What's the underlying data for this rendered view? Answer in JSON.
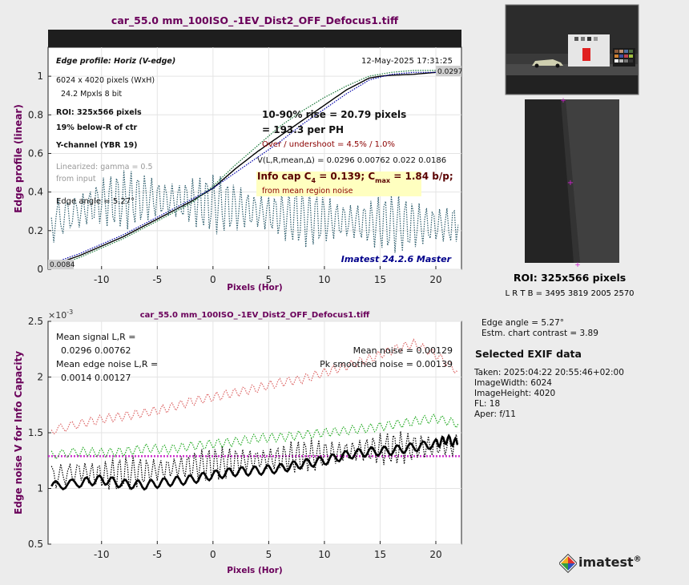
{
  "window": {
    "title": "car_55.0 mm_100ISO_-1EV_Dist2_OFF_Defocus1.tiff"
  },
  "top_panel": {
    "header": "Edge profile: Horiz (V-edge)",
    "date": "12-May-2025 17:31:25",
    "pixels": "6024 x 4020 pixels (WxH)",
    "mpx": "24.2 Mpxls  8 bit",
    "roi": "ROI:  325x566 pixels",
    "below": "19% below-R of ctr",
    "channel": "Y-channel  (YBR 19)",
    "linearized_1": "Linearized: gamma = 0.5",
    "linearized_2": "from input",
    "edge_angle": "Edge angle = 5.27°",
    "rise_1": "10-90% rise = 20.79 pixels",
    "rise_2": "=  193.3 per PH",
    "overshoot": "Over / undershoot =  4.5% /  1.0%",
    "vlr": "V(L,R,mean,Δ) = 0.0296  0.00762  0.022  0.0186",
    "info_cap_prefix": "Info cap C",
    "info_cap_sub": "4",
    "info_cap_mid": " = 0.139;  C",
    "info_cap_sub2": "max",
    "info_cap_end": " = 1.84 b/p;",
    "info_note": "from mean region noise",
    "version": "Imatest 24.2.6 Master",
    "left_value": "0.0084",
    "right_value": "0.0297"
  },
  "bottom_panel": {
    "title": "car_55.0 mm_100ISO_-1EV_Dist2_OFF_Defocus1.tiff",
    "exponent": "×10",
    "exponent_pow": "-3",
    "mean_signal_label": "Mean signal L,R =",
    "mean_signal_value": "0.0296  0.00762",
    "mean_edge_noise_label": "Mean edge noise L,R =",
    "mean_edge_noise_value": "0.0014  0.00127",
    "mean_noise": "Mean noise = 0.00129",
    "pk_noise": "Pk smoothed noise = 0.00139"
  },
  "sidebar": {
    "roi_title": "ROI:  325x566 pixels",
    "roi_coords": "L R  T B = 3495 3819  2005 2570",
    "edge_angle": "Edge angle = 5.27°",
    "contrast": "Estm. chart contrast = 3.89",
    "exif_title": "Selected EXIF data",
    "exif": [
      "Taken: 2025:04:22 20:55:46+02:00",
      "ImageWidth:  6024",
      "ImageHeight:  4020",
      "FL:    18",
      "Aper:  f/11"
    ]
  },
  "logo": {
    "text": "imatest",
    "mark": "®"
  },
  "colors": {
    "title": "#6a005a",
    "accent_blue": "#00008b",
    "noise_pink": "#cc33cc",
    "info_bg": "#ffffc0",
    "info_text": "#8b0000"
  },
  "chart_data": [
    {
      "type": "line",
      "title": "",
      "xlabel": "Pixels (Hor)",
      "ylabel": "Edge profile (linear)",
      "xlim": [
        -14.8,
        22.3
      ],
      "ylim": [
        0,
        1.15
      ],
      "xticks": [
        -10,
        -5,
        0,
        5,
        10,
        15,
        20
      ],
      "yticks": [
        0,
        0.2,
        0.4,
        0.6,
        0.8,
        1
      ],
      "series": [
        {
          "color": "#000000",
          "style": "solid",
          "x": [
            -14.5,
            -12,
            -10,
            -8,
            -6,
            -4,
            -2,
            0,
            2,
            4,
            6,
            8,
            10,
            12,
            14,
            15,
            16,
            18,
            20,
            22
          ],
          "y": [
            0.02,
            0.07,
            0.12,
            0.17,
            0.23,
            0.29,
            0.35,
            0.42,
            0.52,
            0.61,
            0.69,
            0.77,
            0.85,
            0.93,
            0.99,
            1.0,
            1.005,
            1.01,
            1.02,
            1.03
          ]
        },
        {
          "color": "#1a7a3a",
          "style": "dotted",
          "x": [
            -14.5,
            -12,
            -10,
            -8,
            -6,
            -4,
            -2,
            0,
            2,
            4,
            6,
            8,
            10,
            12,
            14,
            16,
            18,
            20,
            22
          ],
          "y": [
            0.01,
            0.06,
            0.11,
            0.16,
            0.22,
            0.28,
            0.34,
            0.43,
            0.54,
            0.64,
            0.74,
            0.82,
            0.89,
            0.95,
            1.0,
            1.02,
            1.03,
            1.03,
            1.04
          ]
        },
        {
          "color": "#0000aa",
          "style": "dotted",
          "x": [
            -14.5,
            -12,
            -10,
            -8,
            -6,
            -4,
            -2,
            0,
            2,
            4,
            6,
            8,
            10,
            12,
            14,
            16,
            18,
            20,
            22
          ],
          "y": [
            0.03,
            0.08,
            0.13,
            0.18,
            0.24,
            0.3,
            0.36,
            0.42,
            0.5,
            0.58,
            0.66,
            0.75,
            0.83,
            0.91,
            0.98,
            1.01,
            1.02,
            1.02,
            1.03
          ]
        },
        {
          "color": "#2a5a6a",
          "style": "dotted",
          "noise": true,
          "x": [
            -14.5,
            -12,
            -10,
            -8,
            -6,
            -4,
            -2,
            0,
            2,
            4,
            6,
            8,
            10,
            12,
            14,
            16,
            18,
            20,
            22
          ],
          "y": [
            0.25,
            0.3,
            0.35,
            0.36,
            0.37,
            0.36,
            0.35,
            0.34,
            0.32,
            0.3,
            0.28,
            0.27,
            0.26,
            0.25,
            0.24,
            0.24,
            0.23,
            0.23,
            0.23
          ]
        }
      ]
    },
    {
      "type": "line",
      "title": "car_55.0 mm_100ISO_-1EV_Dist2_OFF_Defocus1.tiff",
      "xlabel": "Pixels (Hor)",
      "ylabel": "Edge noise V for Info Capacity",
      "xlim": [
        -14.8,
        22.3
      ],
      "ylim": [
        0.5,
        2.5
      ],
      "xticks": [
        -10,
        -5,
        0,
        5,
        10,
        15,
        20
      ],
      "yticks": [
        0.5,
        1,
        1.5,
        2,
        2.5
      ],
      "hline": 1.29,
      "series": [
        {
          "color": "#000000",
          "style": "thick",
          "x": [
            -14.5,
            -12,
            -10,
            -8,
            -6,
            -4,
            -2,
            0,
            2,
            4,
            6,
            8,
            10,
            12,
            14,
            16,
            18,
            20,
            21,
            22
          ],
          "y": [
            1.02,
            1.05,
            1.08,
            1.04,
            1.03,
            1.06,
            1.08,
            1.12,
            1.15,
            1.16,
            1.18,
            1.22,
            1.25,
            1.3,
            1.33,
            1.34,
            1.37,
            1.4,
            1.44,
            1.4
          ]
        },
        {
          "color": "#000000",
          "style": "dotted",
          "noise": true,
          "x": [
            -14.5,
            -12,
            -10,
            -8,
            -6,
            -4,
            -2,
            0,
            2,
            4,
            6,
            8,
            10,
            12,
            14,
            16,
            18,
            20,
            22
          ],
          "y": [
            1.1,
            1.15,
            1.12,
            1.14,
            1.15,
            1.18,
            1.2,
            1.22,
            1.24,
            1.26,
            1.27,
            1.29,
            1.31,
            1.33,
            1.35,
            1.36,
            1.37,
            1.38,
            1.39
          ]
        },
        {
          "color": "#22aa22",
          "style": "dotted",
          "x": [
            -14.5,
            -12,
            -10,
            -8,
            -6,
            -4,
            -2,
            0,
            2,
            4,
            6,
            8,
            10,
            12,
            14,
            16,
            18,
            20,
            22
          ],
          "y": [
            1.3,
            1.33,
            1.32,
            1.33,
            1.36,
            1.35,
            1.38,
            1.4,
            1.42,
            1.45,
            1.46,
            1.48,
            1.5,
            1.52,
            1.54,
            1.57,
            1.6,
            1.63,
            1.58
          ]
        },
        {
          "color": "#dd6666",
          "style": "dotted",
          "x": [
            -14.5,
            -12,
            -10,
            -8,
            -6,
            -4,
            -2,
            0,
            2,
            4,
            6,
            8,
            10,
            12,
            14,
            16,
            18,
            20,
            22
          ],
          "y": [
            1.52,
            1.58,
            1.62,
            1.65,
            1.68,
            1.72,
            1.78,
            1.82,
            1.86,
            1.9,
            1.95,
            1.98,
            2.04,
            2.1,
            2.16,
            2.24,
            2.3,
            2.2,
            2.05
          ]
        }
      ]
    }
  ]
}
